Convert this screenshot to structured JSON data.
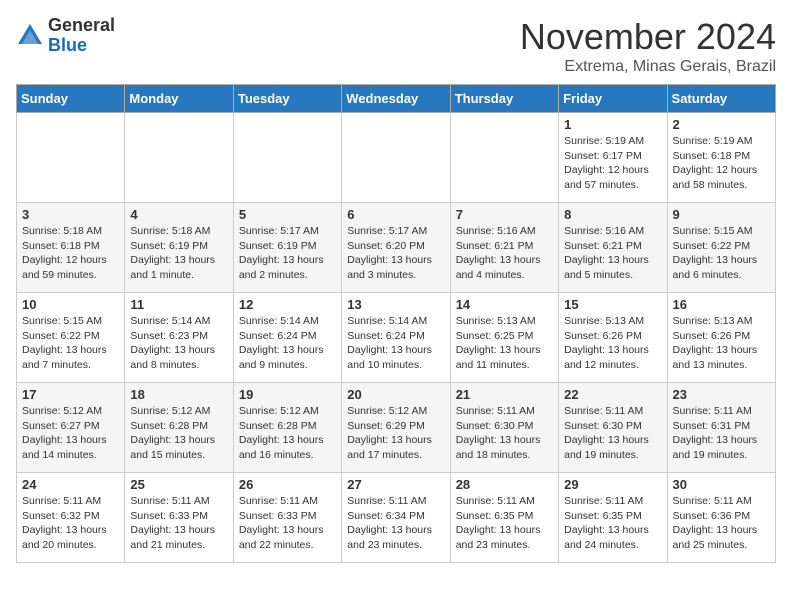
{
  "header": {
    "logo_line1": "General",
    "logo_line2": "Blue",
    "month": "November 2024",
    "location": "Extrema, Minas Gerais, Brazil"
  },
  "weekdays": [
    "Sunday",
    "Monday",
    "Tuesday",
    "Wednesday",
    "Thursday",
    "Friday",
    "Saturday"
  ],
  "weeks": [
    [
      {
        "day": "",
        "info": ""
      },
      {
        "day": "",
        "info": ""
      },
      {
        "day": "",
        "info": ""
      },
      {
        "day": "",
        "info": ""
      },
      {
        "day": "",
        "info": ""
      },
      {
        "day": "1",
        "info": "Sunrise: 5:19 AM\nSunset: 6:17 PM\nDaylight: 12 hours\nand 57 minutes."
      },
      {
        "day": "2",
        "info": "Sunrise: 5:19 AM\nSunset: 6:18 PM\nDaylight: 12 hours\nand 58 minutes."
      }
    ],
    [
      {
        "day": "3",
        "info": "Sunrise: 5:18 AM\nSunset: 6:18 PM\nDaylight: 12 hours\nand 59 minutes."
      },
      {
        "day": "4",
        "info": "Sunrise: 5:18 AM\nSunset: 6:19 PM\nDaylight: 13 hours\nand 1 minute."
      },
      {
        "day": "5",
        "info": "Sunrise: 5:17 AM\nSunset: 6:19 PM\nDaylight: 13 hours\nand 2 minutes."
      },
      {
        "day": "6",
        "info": "Sunrise: 5:17 AM\nSunset: 6:20 PM\nDaylight: 13 hours\nand 3 minutes."
      },
      {
        "day": "7",
        "info": "Sunrise: 5:16 AM\nSunset: 6:21 PM\nDaylight: 13 hours\nand 4 minutes."
      },
      {
        "day": "8",
        "info": "Sunrise: 5:16 AM\nSunset: 6:21 PM\nDaylight: 13 hours\nand 5 minutes."
      },
      {
        "day": "9",
        "info": "Sunrise: 5:15 AM\nSunset: 6:22 PM\nDaylight: 13 hours\nand 6 minutes."
      }
    ],
    [
      {
        "day": "10",
        "info": "Sunrise: 5:15 AM\nSunset: 6:22 PM\nDaylight: 13 hours\nand 7 minutes."
      },
      {
        "day": "11",
        "info": "Sunrise: 5:14 AM\nSunset: 6:23 PM\nDaylight: 13 hours\nand 8 minutes."
      },
      {
        "day": "12",
        "info": "Sunrise: 5:14 AM\nSunset: 6:24 PM\nDaylight: 13 hours\nand 9 minutes."
      },
      {
        "day": "13",
        "info": "Sunrise: 5:14 AM\nSunset: 6:24 PM\nDaylight: 13 hours\nand 10 minutes."
      },
      {
        "day": "14",
        "info": "Sunrise: 5:13 AM\nSunset: 6:25 PM\nDaylight: 13 hours\nand 11 minutes."
      },
      {
        "day": "15",
        "info": "Sunrise: 5:13 AM\nSunset: 6:26 PM\nDaylight: 13 hours\nand 12 minutes."
      },
      {
        "day": "16",
        "info": "Sunrise: 5:13 AM\nSunset: 6:26 PM\nDaylight: 13 hours\nand 13 minutes."
      }
    ],
    [
      {
        "day": "17",
        "info": "Sunrise: 5:12 AM\nSunset: 6:27 PM\nDaylight: 13 hours\nand 14 minutes."
      },
      {
        "day": "18",
        "info": "Sunrise: 5:12 AM\nSunset: 6:28 PM\nDaylight: 13 hours\nand 15 minutes."
      },
      {
        "day": "19",
        "info": "Sunrise: 5:12 AM\nSunset: 6:28 PM\nDaylight: 13 hours\nand 16 minutes."
      },
      {
        "day": "20",
        "info": "Sunrise: 5:12 AM\nSunset: 6:29 PM\nDaylight: 13 hours\nand 17 minutes."
      },
      {
        "day": "21",
        "info": "Sunrise: 5:11 AM\nSunset: 6:30 PM\nDaylight: 13 hours\nand 18 minutes."
      },
      {
        "day": "22",
        "info": "Sunrise: 5:11 AM\nSunset: 6:30 PM\nDaylight: 13 hours\nand 19 minutes."
      },
      {
        "day": "23",
        "info": "Sunrise: 5:11 AM\nSunset: 6:31 PM\nDaylight: 13 hours\nand 19 minutes."
      }
    ],
    [
      {
        "day": "24",
        "info": "Sunrise: 5:11 AM\nSunset: 6:32 PM\nDaylight: 13 hours\nand 20 minutes."
      },
      {
        "day": "25",
        "info": "Sunrise: 5:11 AM\nSunset: 6:33 PM\nDaylight: 13 hours\nand 21 minutes."
      },
      {
        "day": "26",
        "info": "Sunrise: 5:11 AM\nSunset: 6:33 PM\nDaylight: 13 hours\nand 22 minutes."
      },
      {
        "day": "27",
        "info": "Sunrise: 5:11 AM\nSunset: 6:34 PM\nDaylight: 13 hours\nand 23 minutes."
      },
      {
        "day": "28",
        "info": "Sunrise: 5:11 AM\nSunset: 6:35 PM\nDaylight: 13 hours\nand 23 minutes."
      },
      {
        "day": "29",
        "info": "Sunrise: 5:11 AM\nSunset: 6:35 PM\nDaylight: 13 hours\nand 24 minutes."
      },
      {
        "day": "30",
        "info": "Sunrise: 5:11 AM\nSunset: 6:36 PM\nDaylight: 13 hours\nand 25 minutes."
      }
    ]
  ]
}
